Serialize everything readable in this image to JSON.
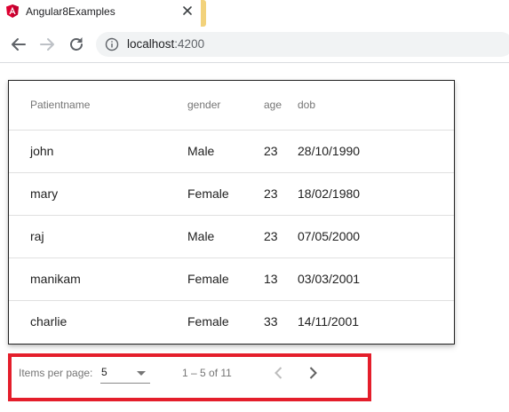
{
  "browser": {
    "tab_title": "Angular8Examples",
    "url_host": "localhost",
    "url_port": ":4200",
    "accent_color": "#f2d27b"
  },
  "table": {
    "columns": [
      "Patientname",
      "gender",
      "age",
      "dob"
    ],
    "rows": [
      [
        "john",
        "Male",
        "23",
        "28/10/1990"
      ],
      [
        "mary",
        "Female",
        "23",
        "18/02/1980"
      ],
      [
        "raj",
        "Male",
        "23",
        "07/05/2000"
      ],
      [
        "manikam",
        "Female",
        "13",
        "03/03/2001"
      ],
      [
        "charlie",
        "Female",
        "33",
        "14/11/2001"
      ]
    ]
  },
  "paginator": {
    "items_per_page_label": "Items per page:",
    "items_per_page_value": "5",
    "range_label": "1 – 5 of 11",
    "highlight_color": "#e41e2b"
  }
}
